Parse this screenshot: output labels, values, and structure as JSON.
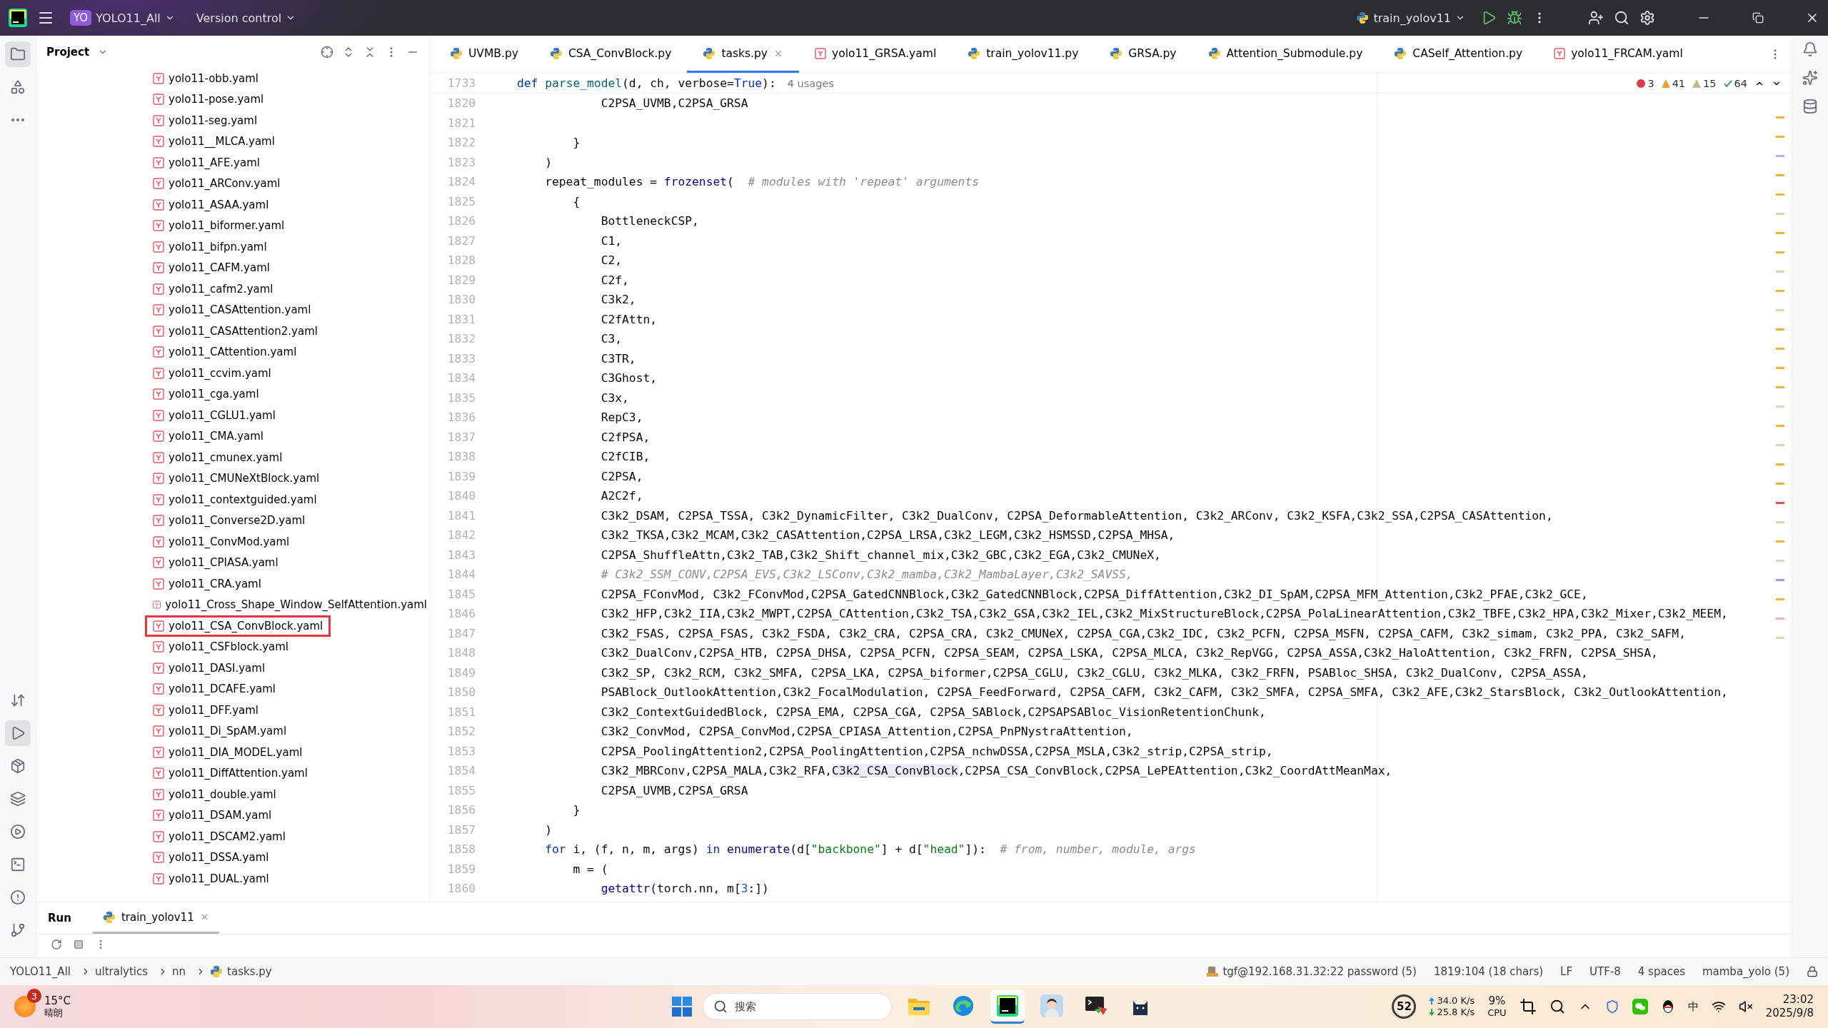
{
  "title_bar": {
    "project_badge": "YO",
    "project": "YOLO11_All",
    "vcs": "Version control",
    "run_config": "train_yolov11"
  },
  "left_toolbar": [
    {
      "kind": "folder",
      "selected": true
    },
    {
      "kind": "structure",
      "selected": false
    },
    {
      "kind": "more",
      "selected": false
    },
    {
      "kind": "commit",
      "selected": false
    },
    {
      "kind": "run",
      "selected": true
    },
    {
      "kind": "packages",
      "selected": false
    },
    {
      "kind": "layers",
      "selected": false
    },
    {
      "kind": "services",
      "selected": false
    },
    {
      "kind": "terminal",
      "selected": false
    },
    {
      "kind": "problems",
      "selected": false
    },
    {
      "kind": "git",
      "selected": false
    }
  ],
  "project": {
    "title": "Project",
    "files": [
      {
        "name": "yolo11-obb.yaml",
        "outlined": false
      },
      {
        "name": "yolo11-pose.yaml",
        "outlined": false
      },
      {
        "name": "yolo11-seg.yaml",
        "outlined": false
      },
      {
        "name": "yolo11__MLCA.yaml",
        "outlined": false
      },
      {
        "name": "yolo11_AFE.yaml",
        "outlined": false
      },
      {
        "name": "yolo11_ARConv.yaml",
        "outlined": false
      },
      {
        "name": "yolo11_ASAA.yaml",
        "outlined": false
      },
      {
        "name": "yolo11_biformer.yaml",
        "outlined": false
      },
      {
        "name": "yolo11_bifpn.yaml",
        "outlined": false
      },
      {
        "name": "yolo11_CAFM.yaml",
        "outlined": false
      },
      {
        "name": "yolo11_cafm2.yaml",
        "outlined": false
      },
      {
        "name": "yolo11_CASAttention.yaml",
        "outlined": false
      },
      {
        "name": "yolo11_CASAttention2.yaml",
        "outlined": false
      },
      {
        "name": "yolo11_CAttention.yaml",
        "outlined": false
      },
      {
        "name": "yolo11_ccvim.yaml",
        "outlined": false
      },
      {
        "name": "yolo11_cga.yaml",
        "outlined": false
      },
      {
        "name": "yolo11_CGLU1.yaml",
        "outlined": false
      },
      {
        "name": "yolo11_CMA.yaml",
        "outlined": false
      },
      {
        "name": "yolo11_cmunex.yaml",
        "outlined": false
      },
      {
        "name": "yolo11_CMUNeXtBlock.yaml",
        "outlined": false
      },
      {
        "name": "yolo11_contextguided.yaml",
        "outlined": false
      },
      {
        "name": "yolo11_Converse2D.yaml",
        "outlined": false
      },
      {
        "name": "yolo11_ConvMod.yaml",
        "outlined": false
      },
      {
        "name": "yolo11_CPIASA.yaml",
        "outlined": false
      },
      {
        "name": "yolo11_CRA.yaml",
        "outlined": false
      },
      {
        "name": "yolo11_Cross_Shape_Window_SelfAttention.yaml",
        "outlined": false
      },
      {
        "name": "yolo11_CSA_ConvBlock.yaml",
        "outlined": true
      },
      {
        "name": "yolo11_CSFblock.yaml",
        "outlined": false
      },
      {
        "name": "yolo11_DASI.yaml",
        "outlined": false
      },
      {
        "name": "yolo11_DCAFE.yaml",
        "outlined": false
      },
      {
        "name": "yolo11_DFF.yaml",
        "outlined": false
      },
      {
        "name": "yolo11_Di_SpAM.yaml",
        "outlined": false
      },
      {
        "name": "yolo11_DIA_MODEL.yaml",
        "outlined": false
      },
      {
        "name": "yolo11_DiffAttention.yaml",
        "outlined": false
      },
      {
        "name": "yolo11_double.yaml",
        "outlined": false
      },
      {
        "name": "yolo11_DSAM.yaml",
        "outlined": false
      },
      {
        "name": "yolo11_DSCAM2.yaml",
        "outlined": false
      },
      {
        "name": "yolo11_DSSA.yaml",
        "outlined": false
      },
      {
        "name": "yolo11_DUAL.yaml",
        "outlined": false
      }
    ]
  },
  "tabs": [
    {
      "label": "UVMB.py",
      "kind": "python",
      "selected": false
    },
    {
      "label": "CSA_ConvBlock.py",
      "kind": "python",
      "selected": false
    },
    {
      "label": "tasks.py",
      "kind": "python",
      "selected": true
    },
    {
      "label": "yolo11_GRSA.yaml",
      "kind": "yaml",
      "selected": false
    },
    {
      "label": "train_yolov11.py",
      "kind": "python",
      "selected": false
    },
    {
      "label": "GRSA.py",
      "kind": "python",
      "selected": false
    },
    {
      "label": "Attention_Submodule.py",
      "kind": "python",
      "selected": false
    },
    {
      "label": "CASelf_Attention.py",
      "kind": "python",
      "selected": false
    },
    {
      "label": "yolo11_FRCAM.yaml",
      "kind": "yaml",
      "selected": false
    }
  ],
  "editor": {
    "sticky": {
      "number": "1733",
      "tokens": [
        {
          "kind": "keyword",
          "text": "def "
        },
        {
          "kind": "function",
          "text": "parse_model"
        },
        {
          "kind": "plain",
          "text": "(d, ch, verbose="
        },
        {
          "kind": "keyword",
          "text": "True"
        },
        {
          "kind": "plain",
          "text": "):"
        }
      ],
      "hint": "4 usages"
    },
    "inspections": [
      {
        "kind": "error",
        "count": "3"
      },
      {
        "kind": "warning",
        "count": "41"
      },
      {
        "kind": "weak",
        "count": "15"
      },
      {
        "kind": "ok",
        "count": "64"
      }
    ],
    "lines": [
      {
        "number": "1820",
        "tokens": [
          {
            "kind": "plain",
            "text": "            C2PSA_UVMB,C2PSA_GRSA"
          }
        ]
      },
      {
        "number": "1821"
      },
      {
        "number": "1822",
        "tokens": [
          {
            "kind": "plain",
            "text": "        }"
          }
        ]
      },
      {
        "number": "1823",
        "tokens": [
          {
            "kind": "plain",
            "text": "    )"
          }
        ]
      },
      {
        "number": "1824",
        "tokens": [
          {
            "kind": "plain",
            "text": "    repeat_modules = "
          },
          {
            "kind": "builtin",
            "text": "frozenset"
          },
          {
            "kind": "plain",
            "text": "(  "
          },
          {
            "kind": "comment",
            "text": "# modules with 'repeat' arguments"
          }
        ]
      },
      {
        "number": "1825",
        "tokens": [
          {
            "kind": "plain",
            "text": "        {"
          }
        ]
      },
      {
        "number": "1826",
        "tokens": [
          {
            "kind": "plain",
            "text": "            BottleneckCSP,"
          }
        ]
      },
      {
        "number": "1827",
        "tokens": [
          {
            "kind": "plain",
            "text": "            C1,"
          }
        ]
      },
      {
        "number": "1828",
        "tokens": [
          {
            "kind": "plain",
            "text": "            C2,"
          }
        ]
      },
      {
        "number": "1829",
        "tokens": [
          {
            "kind": "plain",
            "text": "            C2f,"
          }
        ]
      },
      {
        "number": "1830",
        "tokens": [
          {
            "kind": "plain",
            "text": "            C3k2,"
          }
        ]
      },
      {
        "number": "1831",
        "tokens": [
          {
            "kind": "plain",
            "text": "            C2fAttn,"
          }
        ]
      },
      {
        "number": "1832",
        "tokens": [
          {
            "kind": "plain",
            "text": "            C3,"
          }
        ]
      },
      {
        "number": "1833",
        "tokens": [
          {
            "kind": "plain",
            "text": "            C3TR,"
          }
        ]
      },
      {
        "number": "1834",
        "tokens": [
          {
            "kind": "plain",
            "text": "            C3Ghost,"
          }
        ]
      },
      {
        "number": "1835",
        "tokens": [
          {
            "kind": "plain",
            "text": "            C3x,"
          }
        ]
      },
      {
        "number": "1836",
        "tokens": [
          {
            "kind": "plain",
            "text": "            RepC3,"
          }
        ]
      },
      {
        "number": "1837",
        "tokens": [
          {
            "kind": "plain",
            "text": "            C2fPSA,"
          }
        ]
      },
      {
        "number": "1838",
        "tokens": [
          {
            "kind": "plain",
            "text": "            C2fCIB,"
          }
        ]
      },
      {
        "number": "1839",
        "tokens": [
          {
            "kind": "plain",
            "text": "            C2PSA,"
          }
        ]
      },
      {
        "number": "1840",
        "tokens": [
          {
            "kind": "plain",
            "text": "            A2C2f,"
          }
        ]
      },
      {
        "number": "1841",
        "tokens": [
          {
            "kind": "plain",
            "text": "            C3k2_DSAM, C2PSA_TSSA, C3k2_DynamicFilter, C3k2_DualConv, C2PSA_DeformableAttention, C3k2_ARConv, C3k2_KSFA,C3k2_SSA,C2PSA_CASAttention,"
          }
        ]
      },
      {
        "number": "1842",
        "tokens": [
          {
            "kind": "plain",
            "text": "            C3k2_TKSA,C3k2_MCAM,C3k2_CASAttention,C2PSA_LRSA,C3k2_LEGM,C3k2_HSMSSD,C2PSA_MHSA,"
          }
        ]
      },
      {
        "number": "1843",
        "tokens": [
          {
            "kind": "plain",
            "text": "            C2PSA_ShuffleAttn,C3k2_TAB,C3k2_Shift_channel_mix,C3k2_GBC,C3k2_EGA,C3k2_CMUNeX,"
          }
        ]
      },
      {
        "number": "1844",
        "tokens": [
          {
            "kind": "comment",
            "text": "            # C3k2_SSM_CONV,C2PSA_EVS,C3k2_LSConv,C3k2_mamba,C3k2_MambaLayer,C3k2_SAVSS,"
          }
        ]
      },
      {
        "number": "1845",
        "tokens": [
          {
            "kind": "plain",
            "text": "            C2PSA_FConvMod, C3k2_FConvMod,C2PSA_GatedCNNBlock,C3k2_GatedCNNBlock,C2PSA_DiffAttention,C3k2_DI_SpAM,C2PSA_MFM_Attention,C3k2_PFAE,C3k2_GCE,"
          }
        ]
      },
      {
        "number": "1846",
        "tokens": [
          {
            "kind": "plain",
            "text": "            C3k2_HFP,C3k2_IIA,C3k2_MWPT,C2PSA_CAttention,C3k2_TSA,C3k2_GSA,C3k2_IEL,C3k2_MixStructureBlock,C2PSA_PolaLinearAttention,C3k2_TBFE,C3k2_HPA,C3k2_Mixer,C3k2_MEEM,"
          }
        ]
      },
      {
        "number": "1847",
        "tokens": [
          {
            "kind": "plain",
            "text": "            C3k2_FSAS, C2PSA_FSAS, C3k2_FSDA, C3k2_CRA, C2PSA_CRA, C3k2_CMUNeX, C2PSA_CGA,C3k2_IDC, C3k2_PCFN, C2PSA_MSFN, C2PSA_CAFM, C3k2_simam, C3k2_PPA, C3k2_SAFM,"
          }
        ]
      },
      {
        "number": "1848",
        "tokens": [
          {
            "kind": "plain",
            "text": "            C3k2_DualConv,C2PSA_HTB, C2PSA_DHSA, C2PSA_PCFN, C2PSA_SEAM, C2PSA_LSKA, C2PSA_MLCA, C3k2_RepVGG, C2PSA_ASSA,C3k2_HaloAttention, C3k2_FRFN, C2PSA_SHSA,"
          }
        ]
      },
      {
        "number": "1849",
        "tokens": [
          {
            "kind": "plain",
            "text": "            C3k2_SP, C3k2_RCM, C3k2_SMFA, C2PSA_LKA, C2PSA_biformer,C2PSA_CGLU, C3k2_CGLU, C3k2_MLKA, C3k2_FRFN, PSABloc_SHSA, C3k2_DualConv, C2PSA_ASSA,"
          }
        ]
      },
      {
        "number": "1850",
        "tokens": [
          {
            "kind": "plain",
            "text": "            PSABlock_OutlookAttention,C3k2_FocalModulation, C2PSA_FeedForward, C2PSA_CAFM, C3k2_CAFM, C3k2_SMFA, C2PSA_SMFA, C3k2_AFE,C3k2_StarsBlock, C3k2_OutlookAttention,"
          }
        ]
      },
      {
        "number": "1851",
        "tokens": [
          {
            "kind": "plain",
            "text": "            C3k2_ContextGuidedBlock, C2PSA_EMA, C2PSA_CGA, C2PSA_SABlock,C2PSAPSABloc_VisionRetentionChunk,"
          }
        ]
      },
      {
        "number": "1852",
        "tokens": [
          {
            "kind": "plain",
            "text": "            C3k2_ConvMod, C2PSA_ConvMod,C2PSA_CPIASA_Attention,C2PSA_PnPNystraAttention,"
          }
        ]
      },
      {
        "number": "1853",
        "tokens": [
          {
            "kind": "plain",
            "text": "            C2PSA_PoolingAttention2,C2PSA_PoolingAttention,C2PSA_nchwDSSA,C2PSA_MSLA,C3k2_strip,C2PSA_strip,"
          }
        ]
      },
      {
        "number": "1854",
        "tokens": [
          {
            "kind": "plain",
            "text": "            C3k2_MBRConv,C2PSA_MALA,C3k2_RFA,"
          },
          {
            "kind": "highlight",
            "text": "C3k2_CSA_ConvBlock"
          },
          {
            "kind": "plain",
            "text": ",C2PSA_CSA_ConvBlock,C2PSA_LePEAttention,C3k2_CoordAttMeanMax,"
          }
        ]
      },
      {
        "number": "1855",
        "tokens": [
          {
            "kind": "plain",
            "text": "            C2PSA_UVMB,C2PSA_GRSA"
          }
        ]
      },
      {
        "number": "1856",
        "tokens": [
          {
            "kind": "plain",
            "text": "        }"
          }
        ]
      },
      {
        "number": "1857",
        "tokens": [
          {
            "kind": "plain",
            "text": "    )"
          }
        ]
      },
      {
        "number": "1858",
        "tokens": [
          {
            "kind": "keyword",
            "text": "    for"
          },
          {
            "kind": "plain",
            "text": " i, (f, n, m, args) "
          },
          {
            "kind": "keyword",
            "text": "in "
          },
          {
            "kind": "builtin",
            "text": "enumerate"
          },
          {
            "kind": "plain",
            "text": "(d["
          },
          {
            "kind": "string",
            "text": "\"backbone\""
          },
          {
            "kind": "plain",
            "text": "] + d["
          },
          {
            "kind": "string",
            "text": "\"head\""
          },
          {
            "kind": "plain",
            "text": "]):  "
          },
          {
            "kind": "comment",
            "text": "# from, number, module, args"
          }
        ]
      },
      {
        "number": "1859",
        "tokens": [
          {
            "kind": "plain",
            "text": "        m = ("
          }
        ]
      },
      {
        "number": "1860",
        "tokens": [
          {
            "kind": "builtin",
            "text": "            getattr"
          },
          {
            "kind": "plain",
            "text": "(torch.nn, m["
          },
          {
            "kind": "number",
            "text": "3"
          },
          {
            "kind": "plain",
            "text": ":])"
          }
        ]
      }
    ]
  },
  "run_panel": {
    "title": "Run",
    "tabs": [
      {
        "label": "train_yolov11",
        "selected": true
      }
    ]
  },
  "breadcrumb": [
    "YOLO11_All",
    "ultralytics",
    "nn",
    "tasks.py"
  ],
  "status_bar": {
    "connection": "tgf@192.168.31.32:22 password (5)",
    "position": "1819:104 (18 chars)",
    "line_ending": "LF",
    "encoding": "UTF-8",
    "indent": "4 spaces",
    "interpreter": "mamba_yolo (5)"
  },
  "taskbar": {
    "weather_badge": "3",
    "temperature": "15°C",
    "condition": "晴朗",
    "search_placeholder": "搜索",
    "apps": [
      {
        "kind": "files",
        "selected": false
      },
      {
        "kind": "edge",
        "selected": false
      },
      {
        "kind": "pycharm",
        "selected": true
      },
      {
        "kind": "avatar",
        "selected": false
      },
      {
        "kind": "terminal",
        "selected": false
      },
      {
        "kind": "cat",
        "selected": false
      }
    ],
    "score": "52",
    "upload": "34.0 K/s",
    "download": "25.8 K/s",
    "cpu": "9%",
    "cpu_label": "CPU",
    "ime": "中",
    "time": "23:02",
    "date": "2025/9/8"
  }
}
